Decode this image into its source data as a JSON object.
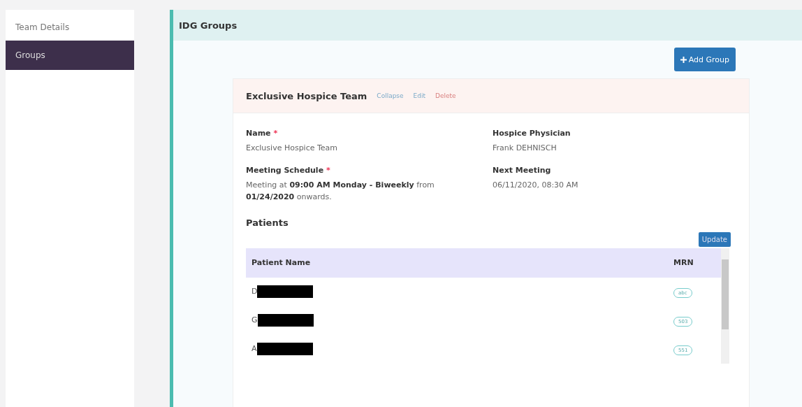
{
  "sidebar": {
    "items": [
      {
        "label": "Team Details",
        "selected": false
      },
      {
        "label": "Groups",
        "selected": true
      }
    ]
  },
  "panel": {
    "title": "IDG Groups",
    "add_button": "Add Group"
  },
  "group": {
    "title": "Exclusive Hospice Team",
    "actions": [
      {
        "label": "Collapse",
        "kind": "link"
      },
      {
        "label": "Edit",
        "kind": "link"
      },
      {
        "label": "Delete",
        "kind": "danger"
      }
    ],
    "fields": [
      {
        "label": "Name",
        "required_mark": "*",
        "value": "Exclusive Hospice Team"
      },
      {
        "label": "Hospice Physician",
        "value": "Frank DEHNISCH"
      },
      {
        "label": "Meeting Schedule",
        "required_mark": "*",
        "value": "Meeting at **09:00 AM Monday - Biweekly** from **01/24/2020** onwards."
      },
      {
        "label": "Next Meeting",
        "value": "06/11/2020, 08:30 AM"
      }
    ],
    "patients_title": "Patients",
    "update_button": "Update",
    "columns": [
      "Patient Name",
      "MRN"
    ],
    "rows": [
      {
        "name": "D",
        "redacted": true,
        "mrn": "abc"
      },
      {
        "name": "G",
        "redacted": true,
        "mrn": "503"
      },
      {
        "name": "A",
        "redacted": true,
        "mrn": "551"
      }
    ]
  }
}
